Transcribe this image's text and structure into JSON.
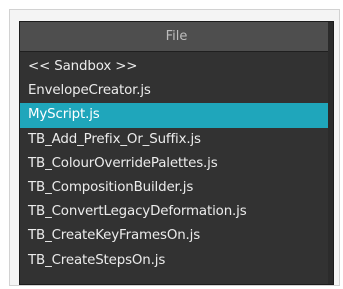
{
  "file_list": {
    "header": "File",
    "items": [
      {
        "label": "<< Sandbox >>",
        "selected": false
      },
      {
        "label": "EnvelopeCreator.js",
        "selected": false
      },
      {
        "label": "MyScript.js",
        "selected": true
      },
      {
        "label": "TB_Add_Prefix_Or_Suffix.js",
        "selected": false
      },
      {
        "label": "TB_ColourOverridePalettes.js",
        "selected": false
      },
      {
        "label": "TB_CompositionBuilder.js",
        "selected": false
      },
      {
        "label": "TB_ConvertLegacyDeformation.js",
        "selected": false
      },
      {
        "label": "TB_CreateKeyFramesOn.js",
        "selected": false
      },
      {
        "label": "TB_CreateStepsOn.js",
        "selected": false
      }
    ]
  },
  "colors": {
    "panel_bg": "#323232",
    "header_bg": "#4e4e4e",
    "selection": "#1fa6bb",
    "text": "#ececec"
  }
}
